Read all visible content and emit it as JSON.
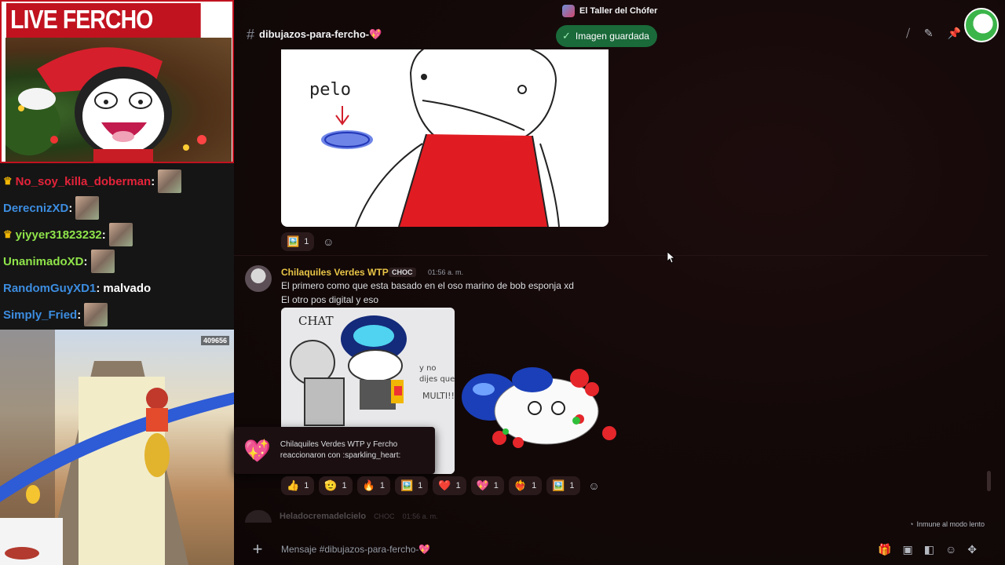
{
  "overlay": {
    "title": "LIVE FERCHO REACTION",
    "chat": [
      {
        "user": "No_soy_killa_doberman",
        "color": "#e4233a",
        "crown": true,
        "message": "",
        "emote": true
      },
      {
        "user": "DerecnizXD",
        "color": "#3c8de0",
        "crown": false,
        "message": "",
        "emote": true
      },
      {
        "user": "yiyyer31823232",
        "color": "#8fe44a",
        "crown": true,
        "message": "",
        "emote": true
      },
      {
        "user": "UnanimadoXD",
        "color": "#8fe44a",
        "crown": false,
        "message": "",
        "emote": true
      },
      {
        "user": "RandomGuyXD1",
        "color": "#3c8de0",
        "crown": false,
        "message": "malvado",
        "emote": false
      },
      {
        "user": "Simply_Fried",
        "color": "#3c8de0",
        "crown": false,
        "message": "",
        "emote": true
      }
    ],
    "game_score": "409656"
  },
  "server": {
    "name": "El Taller del Chófer"
  },
  "channel": {
    "name": "dibujazos-para-fercho-💖",
    "hash": "#"
  },
  "toast": {
    "text": "Imagen guardada",
    "icon": "check-icon"
  },
  "drawing1": {
    "label": "pelo"
  },
  "reactions1": [
    {
      "emoji": "🖼️",
      "count": "1"
    }
  ],
  "message2": {
    "author": "Chilaquiles Verdes WTP",
    "tag": "CHOC",
    "time": "01:56 a. m.",
    "lines": [
      "El primero como que esta basado en el oso marino de bob esponja xd",
      "El otro pos digital y eso"
    ],
    "image_text": "CHAT"
  },
  "reactions2": [
    {
      "emoji": "👍",
      "count": "1"
    },
    {
      "emoji": "🫡",
      "count": "1"
    },
    {
      "emoji": "🔥",
      "count": "1"
    },
    {
      "emoji": "🖼️",
      "count": "1"
    },
    {
      "emoji": "❤️",
      "count": "1"
    },
    {
      "emoji": "💖",
      "count": "1"
    },
    {
      "emoji": "❤️‍🔥",
      "count": "1"
    },
    {
      "emoji": "🖼️",
      "count": "1"
    }
  ],
  "react_popup": {
    "line1": "Chilaquiles Verdes WTP y Fercho",
    "line2": "reaccionaron con :sparkling_heart:"
  },
  "message3": {
    "author": "Heladocremadelcielo",
    "tag": "CHOC",
    "time": "01:56 a. m."
  },
  "slowmode": "Inmune al modo lento",
  "composer": {
    "placeholder": "Mensaje #dibujazos-para-fercho-💖"
  }
}
